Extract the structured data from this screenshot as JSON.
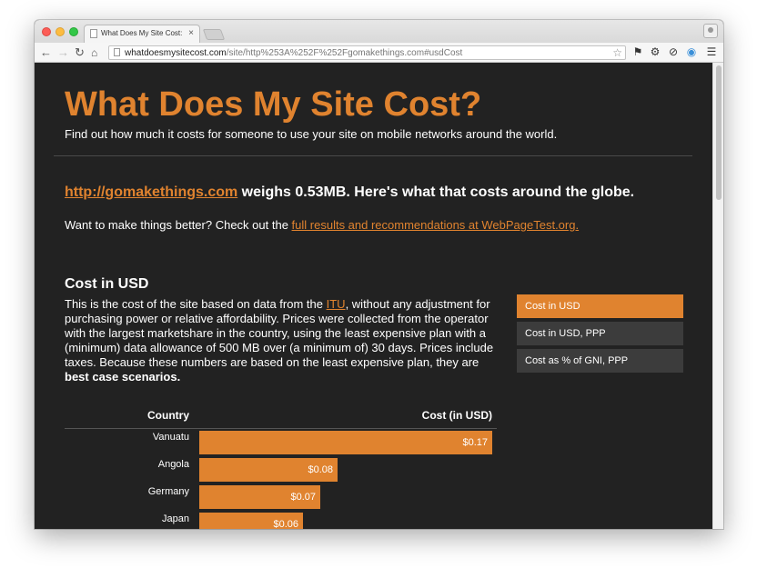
{
  "browser": {
    "tab_title": "What Does My Site Cost: I",
    "tab_close": "×",
    "url_host": "whatdoesmysitecost.com",
    "url_path": "/site/http%253A%252F%252Fgomakethings.com#usdCost",
    "icons": {
      "back": "arrow-left",
      "forward": "arrow-right",
      "reload": "reload",
      "home": "home",
      "star": "star",
      "extensions": [
        "extension-a",
        "gear",
        "block",
        "color-wheel"
      ],
      "menu": "hamburger-menu",
      "profile": "user"
    }
  },
  "header": {
    "title": "What Does My Site Cost?",
    "tagline": "Find out how much it costs for someone to use your site on mobile networks around the world."
  },
  "summary": {
    "site_link": "http://gomakethings.com",
    "weighs_text": " weighs 0.53MB. Here's what that costs around the globe.",
    "better_prefix": "Want to make things better? Check out the ",
    "better_link": "full results and recommendations at WebPageTest.org."
  },
  "section": {
    "title": "Cost in USD",
    "desc_part1": "This is the cost of the site based on data from the ",
    "desc_link": "ITU",
    "desc_part2": ", without any adjustment for purchasing power or relative affordability. Prices were collected from the operator with the largest marketshare in the country, using the least expensive plan with a (minimum) data allowance of 500 MB over (a minimum of) 30 days. Prices include taxes. Because these numbers are based on the least expensive plan, they are ",
    "desc_bold": "best case scenarios."
  },
  "sidebar": {
    "items": [
      {
        "label": "Cost in USD",
        "active": true
      },
      {
        "label": "Cost in USD, PPP",
        "active": false
      },
      {
        "label": "Cost as % of GNI, PPP",
        "active": false
      }
    ]
  },
  "table": {
    "col_country": "Country",
    "col_cost": "Cost (in USD)",
    "rows": [
      {
        "country": "Vanuatu",
        "cost_label": "$0.17",
        "value": 0.17
      },
      {
        "country": "Angola",
        "cost_label": "$0.08",
        "value": 0.08
      },
      {
        "country": "Germany",
        "cost_label": "$0.07",
        "value": 0.07
      },
      {
        "country": "Japan",
        "cost_label": "$0.06",
        "value": 0.06
      }
    ]
  },
  "colors": {
    "accent": "#e0832f",
    "page_bg": "#222222",
    "inactive_button": "#3c3c3c"
  }
}
